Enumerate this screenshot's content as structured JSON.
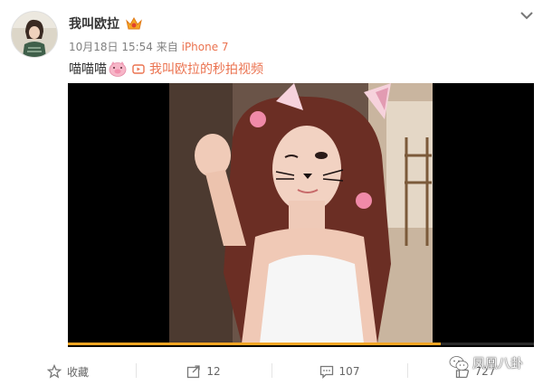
{
  "post": {
    "author": "我叫欧拉",
    "date": "10月18日 15:54",
    "via": "来自",
    "device": "iPhone 7",
    "text": "喵喵喵",
    "video_link": "我叫欧拉的秒拍视频"
  },
  "video": {
    "progress": 0.8
  },
  "actions": {
    "favorite": "收藏",
    "forward": "12",
    "comment": "107",
    "like": "727"
  },
  "watermark": "凤凰八卦",
  "colors": {
    "accent": "#eb7350",
    "progress": "#f5a623"
  }
}
